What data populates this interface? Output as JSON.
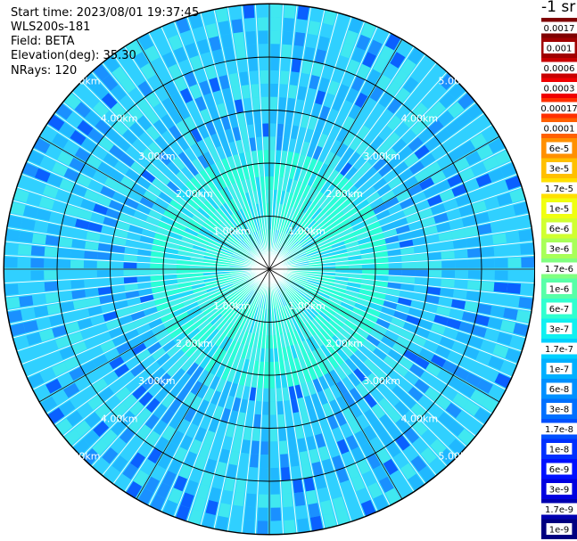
{
  "header": {
    "start_time": "Start time: 2023/08/01 19:37:45",
    "instrument": "WLS200s-181",
    "field": "Field: BETA",
    "elevation": "Elevation(deg): 35.30",
    "nrays": "NRays: 120"
  },
  "colorbar": {
    "unit": "-1 sr",
    "labels": [
      "0.0017",
      "0.001",
      "0.0006",
      "0.0003",
      "0.00017",
      "0.0001",
      "6e-5",
      "3e-5",
      "1.7e-5",
      "1e-5",
      "6e-6",
      "3e-6",
      "1.7e-6",
      "1e-6",
      "6e-7",
      "3e-7",
      "1.7e-7",
      "1e-7",
      "6e-8",
      "3e-8",
      "1.7e-8",
      "1e-8",
      "6e-9",
      "3e-9",
      "1.7e-9",
      "1e-9"
    ],
    "colors": [
      "#7f0000",
      "#a00000",
      "#c80000",
      "#f00000",
      "#ff3000",
      "#ff6000",
      "#ff9000",
      "#ffc000",
      "#ffe000",
      "#f0ff10",
      "#d0ff30",
      "#a8ff58",
      "#80ff80",
      "#58ffa8",
      "#30ffd0",
      "#10f0f0",
      "#00d0ff",
      "#00b0ff",
      "#0090ff",
      "#0070ff",
      "#0050ff",
      "#0030ff",
      "#0010ff",
      "#0000e0",
      "#0000b0",
      "#000080"
    ]
  },
  "chart_data": {
    "type": "heatmap",
    "projection": "polar PPI",
    "rays": 120,
    "range_rings_km": [
      1,
      2,
      3,
      4,
      5
    ],
    "ring_labels": [
      "1.00km",
      "2.00km",
      "3.00km",
      "4.00km",
      "5.00km"
    ],
    "spokes": 12,
    "field": "BETA",
    "value_range": [
      "1e-9",
      "0.0017"
    ],
    "dominant_values": {
      "inner_0_to_2km": "1.7e-7 to 3e-7",
      "outer_2_to_5km": "3e-8 to 1e-7"
    }
  }
}
